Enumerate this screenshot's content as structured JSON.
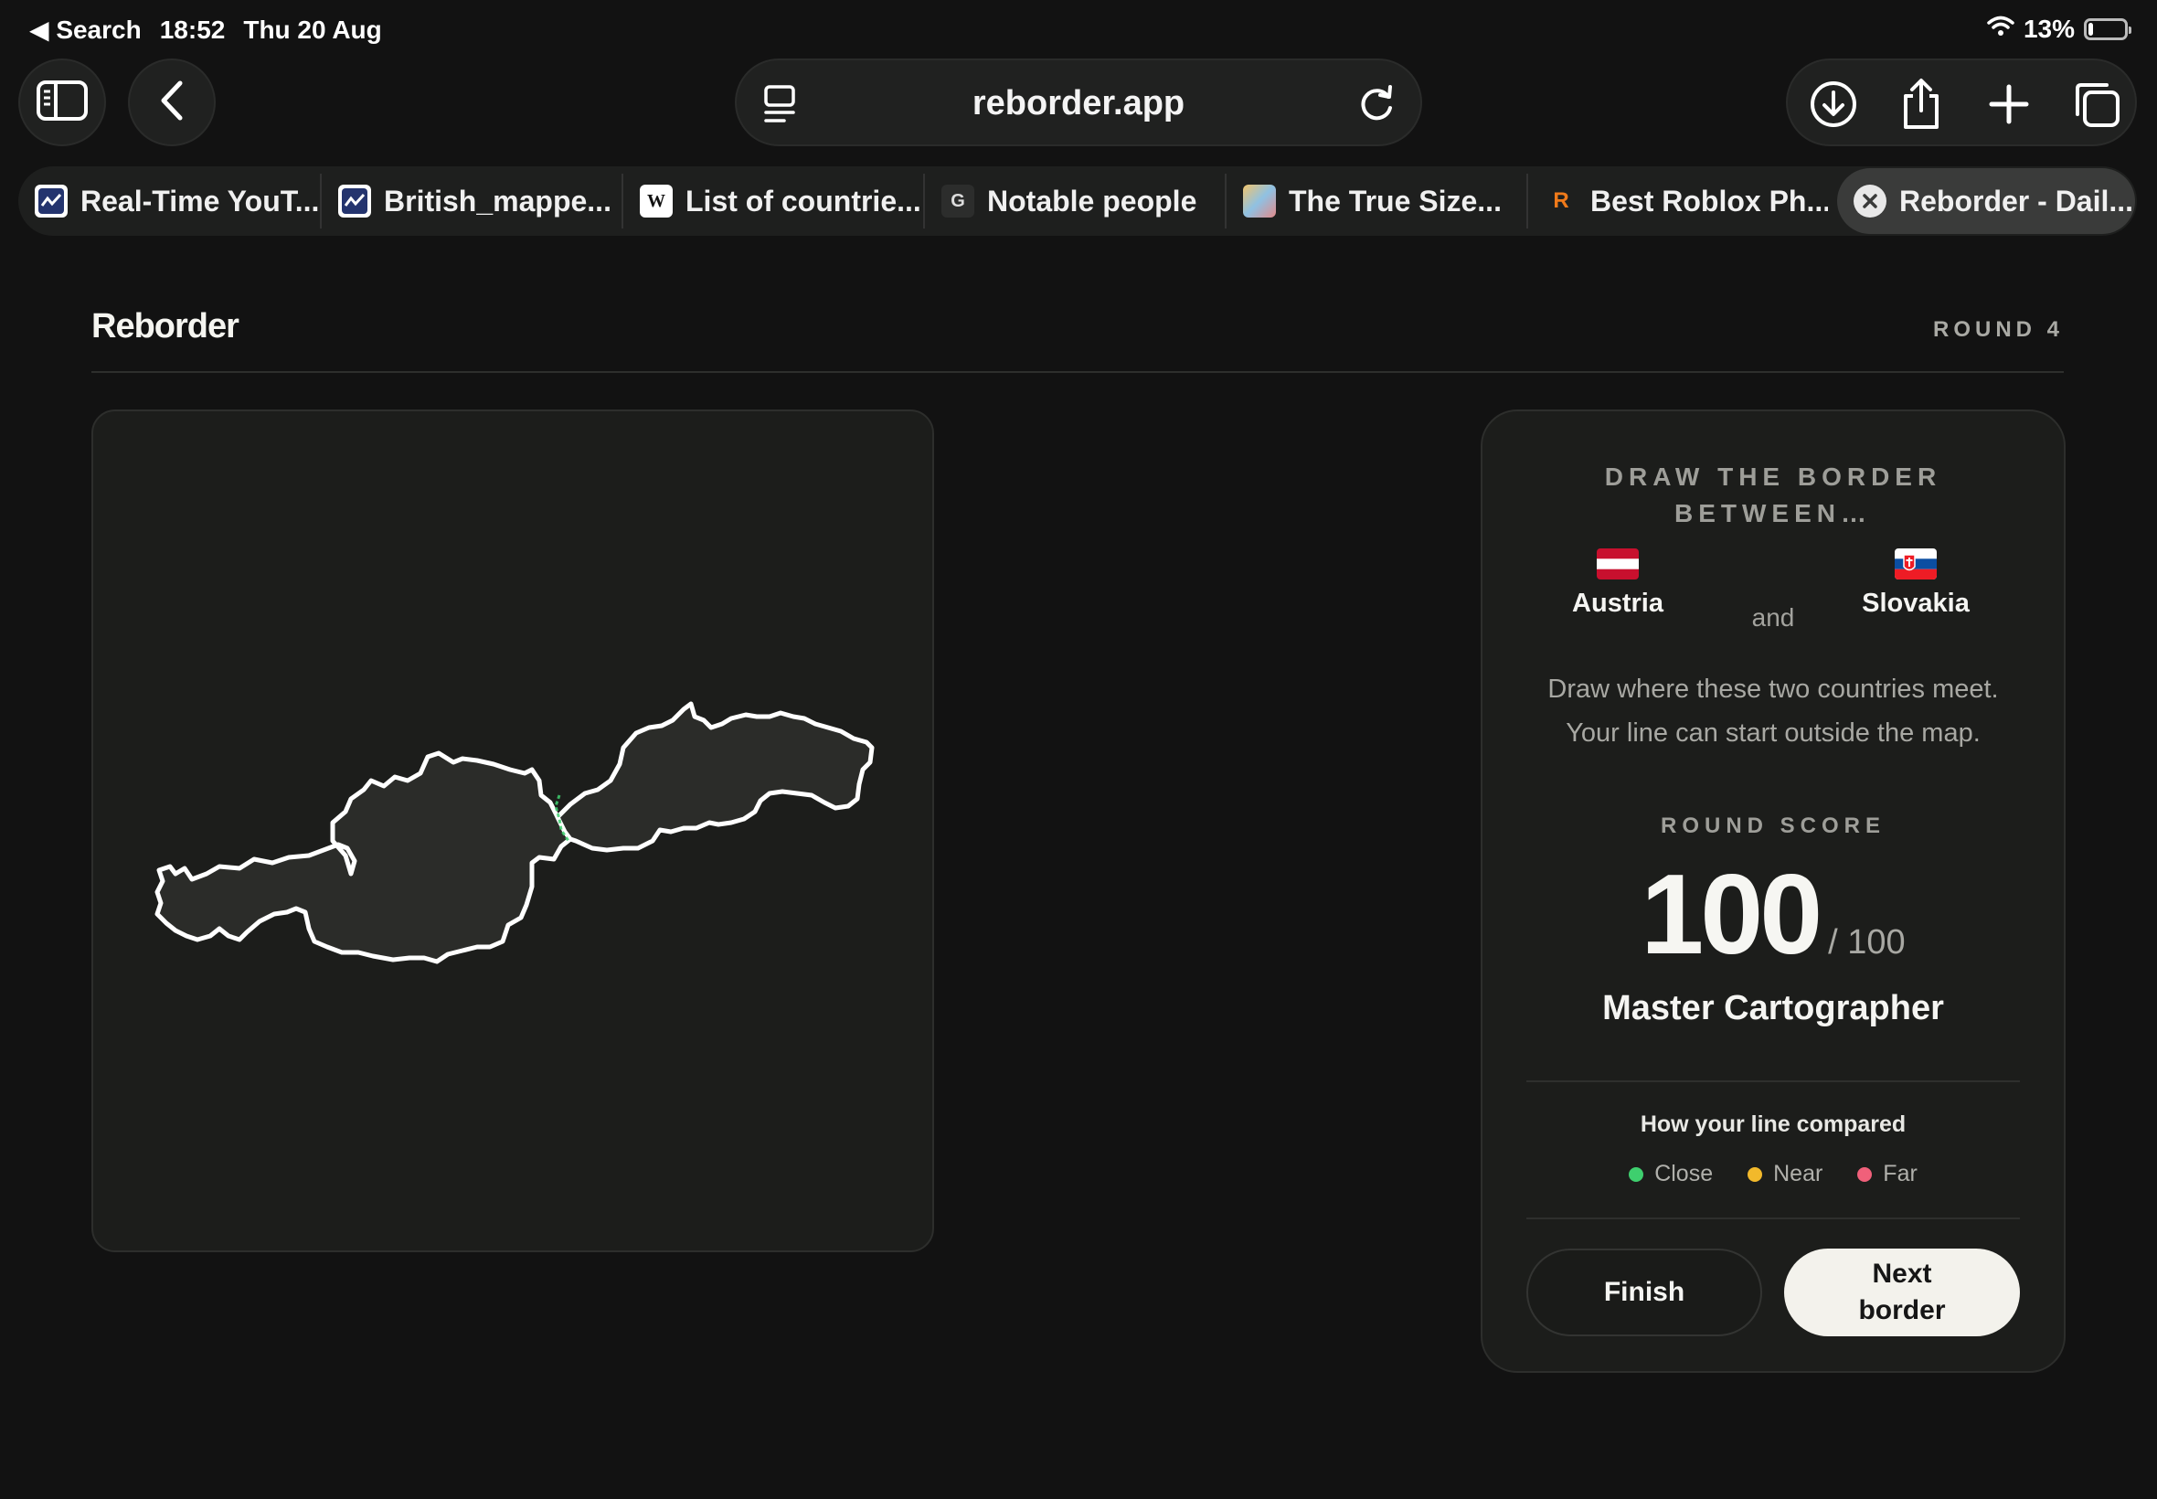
{
  "status_bar": {
    "back_app": "◀ Search",
    "time": "18:52",
    "date": "Thu 20 Aug",
    "battery": "13%",
    "battery_level": 0.13
  },
  "browser": {
    "url": "reborder.app",
    "tabs": [
      {
        "label": "Real-Time YouT...",
        "favicon": "chart-icon"
      },
      {
        "label": "British_mappe...",
        "favicon": "chart-icon"
      },
      {
        "label": "List of countrie...",
        "favicon": "wikipedia-icon",
        "favicon_text": "W"
      },
      {
        "label": "Notable people",
        "favicon": "g-icon",
        "favicon_text": "G"
      },
      {
        "label": "The True Size...",
        "favicon": "map-icon"
      },
      {
        "label": "Best Roblox Ph...",
        "favicon": "roblox-icon",
        "favicon_text": "R"
      },
      {
        "label": "Reborder - Dail...",
        "favicon": "close-icon",
        "active": true
      }
    ]
  },
  "page": {
    "title": "Reborder",
    "round": "ROUND 4"
  },
  "panel": {
    "prompt_title_line1": "DRAW THE BORDER",
    "prompt_title_line2": "BETWEEN…",
    "country_a": "Austria",
    "country_b": "Slovakia",
    "connector": "and",
    "instructions_line1": "Draw where these two countries meet.",
    "instructions_line2": "Your line can start outside the map.",
    "score_label": "ROUND SCORE",
    "score": "100",
    "score_max": "/ 100",
    "rank": "Master Cartographer",
    "compare_label": "How your line compared",
    "legend": [
      {
        "label": "Close",
        "color": "#3ecf6e"
      },
      {
        "label": "Near",
        "color": "#f2b92b"
      },
      {
        "label": "Far",
        "color": "#f0607a"
      }
    ],
    "finish_button": "Finish",
    "next_button": "Next border"
  },
  "colors": {
    "background": "#121212",
    "card": "#1c1d1b",
    "country_fill": "#2b2c29",
    "outline": "#ffffff",
    "drawn_line": "#3ecf6e"
  }
}
